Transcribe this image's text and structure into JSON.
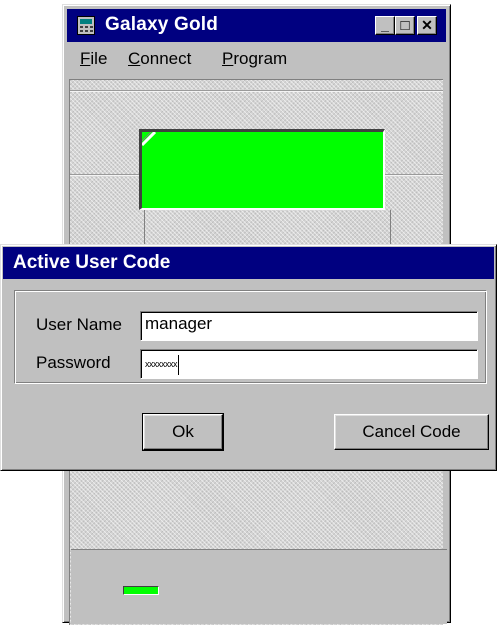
{
  "main_window": {
    "title": "Galaxy Gold",
    "controls": {
      "minimize": "_",
      "maximize": "□",
      "close": "✕"
    },
    "menu": [
      {
        "label": "File",
        "accel": "F",
        "rest": "ile"
      },
      {
        "label": "Connect",
        "accel": "C",
        "rest": "onnect"
      },
      {
        "label": "Program",
        "accel": "P",
        "rest": "rogram"
      }
    ],
    "display_color": "#00ff00"
  },
  "dialog": {
    "title": "Active User Code",
    "username_label": "User Name",
    "username_value": "manager",
    "password_label": "Password",
    "password_value": "xxxxxxxx",
    "ok_label": "Ok",
    "cancel_label": "Cancel Code"
  },
  "colors": {
    "title_bar": "#000080",
    "face": "#c0c0c0",
    "lcd": "#00ff00"
  },
  "icons": [
    "app-calculator-icon",
    "minimize-icon",
    "maximize-icon",
    "close-icon"
  ]
}
